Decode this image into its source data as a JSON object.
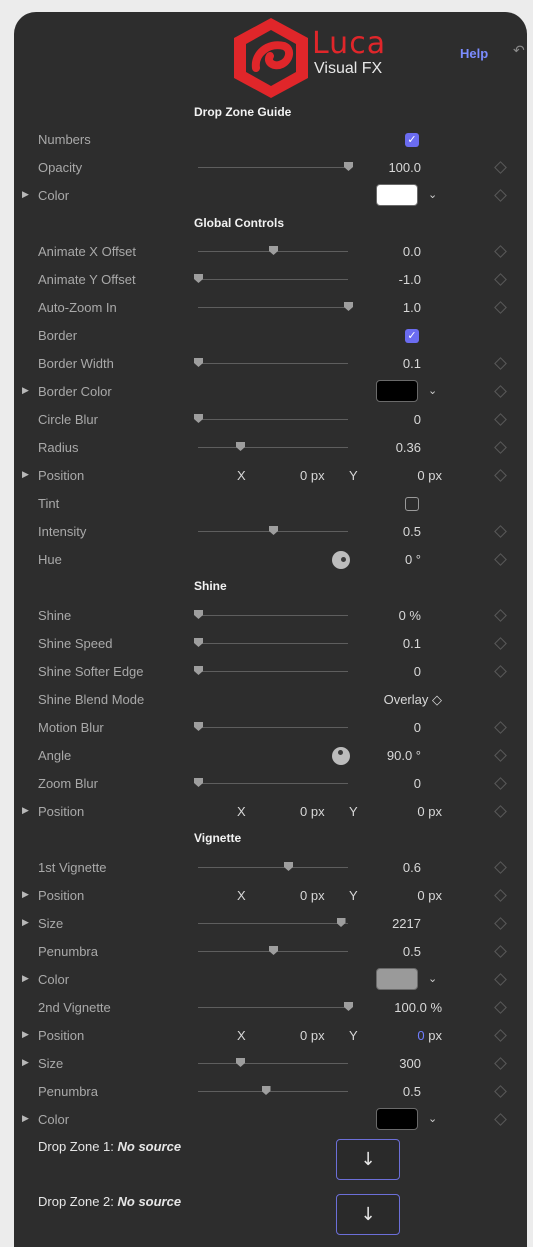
{
  "header": {
    "brand_name": "Luca",
    "brand_sub": "Visual FX",
    "help_label": "Help",
    "accent_color": "#e0262a",
    "help_color": "#7b8cff"
  },
  "sections": {
    "drop_zone_guide": "Drop Zone Guide",
    "global_controls": "Global Controls",
    "shine": "Shine",
    "vignette": "Vignette"
  },
  "rows": {
    "numbers": {
      "label": "Numbers",
      "checked": true
    },
    "opacity": {
      "label": "Opacity",
      "value": "100.0",
      "level": 1.0
    },
    "color1": {
      "label": "Color",
      "swatch": "#ffffff"
    },
    "anim_x": {
      "label": "Animate X Offset",
      "value": "0.0",
      "level": 0.5
    },
    "anim_y": {
      "label": "Animate Y Offset",
      "value": "-1.0",
      "level": 0.0
    },
    "autozoom": {
      "label": "Auto-Zoom In",
      "value": "1.0",
      "level": 1.0
    },
    "border": {
      "label": "Border",
      "checked": true
    },
    "border_width": {
      "label": "Border Width",
      "value": "0.1",
      "level": 0.0
    },
    "border_color": {
      "label": "Border Color",
      "swatch": "#000000"
    },
    "circle_blur": {
      "label": "Circle Blur",
      "value": "0",
      "level": 0.0
    },
    "radius": {
      "label": "Radius",
      "value": "0.36",
      "level": 0.28
    },
    "position1": {
      "label": "Position",
      "x_label": "X",
      "x_value": "0 px",
      "y_label": "Y",
      "y_value": "0 px"
    },
    "tint": {
      "label": "Tint",
      "checked": false
    },
    "intensity": {
      "label": "Intensity",
      "value": "0.5",
      "level": 0.5
    },
    "hue": {
      "label": "Hue",
      "value": "0 °"
    },
    "shine": {
      "label": "Shine",
      "value": "0 %",
      "level": 0.0
    },
    "shine_speed": {
      "label": "Shine Speed",
      "value": "0.1",
      "level": 0.0
    },
    "shine_softer": {
      "label": "Shine Softer Edge",
      "value": "0",
      "level": 0.0
    },
    "shine_blend": {
      "label": "Shine Blend Mode",
      "value": "Overlay ◇"
    },
    "motion_blur": {
      "label": "Motion Blur",
      "value": "0",
      "level": 0.0
    },
    "angle": {
      "label": "Angle",
      "value": "90.0 °"
    },
    "zoom_blur": {
      "label": "Zoom Blur",
      "value": "0",
      "level": 0.0
    },
    "position2": {
      "label": "Position",
      "x_label": "X",
      "x_value": "0 px",
      "y_label": "Y",
      "y_value": "0 px"
    },
    "vig1": {
      "label": "1st Vignette",
      "value": "0.6",
      "level": 0.6
    },
    "position3": {
      "label": "Position",
      "x_label": "X",
      "x_value": "0 px",
      "y_label": "Y",
      "y_value": "0 px"
    },
    "size1": {
      "label": "Size",
      "value": "2217",
      "level": 0.95
    },
    "penumbra1": {
      "label": "Penumbra",
      "value": "0.5",
      "level": 0.5
    },
    "color2": {
      "label": "Color",
      "swatch": "#9a9a9a"
    },
    "vig2": {
      "label": "2nd Vignette",
      "value": "100.0 %",
      "level": 1.0
    },
    "position4": {
      "label": "Position",
      "x_label": "X",
      "x_value": "0 px",
      "y_label": "Y",
      "y_value_num": "0",
      "y_value_unit": "px"
    },
    "size2": {
      "label": "Size",
      "value": "300",
      "level": 0.28
    },
    "penumbra2": {
      "label": "Penumbra",
      "value": "0.5",
      "level": 0.45
    },
    "color3": {
      "label": "Color",
      "swatch": "#000000"
    }
  },
  "drop_zones": {
    "dz1_label": "Drop Zone 1:",
    "dz1_source": "No source",
    "dz2_label": "Drop Zone 2:",
    "dz2_source": "No source",
    "button_glyph": "↓"
  }
}
